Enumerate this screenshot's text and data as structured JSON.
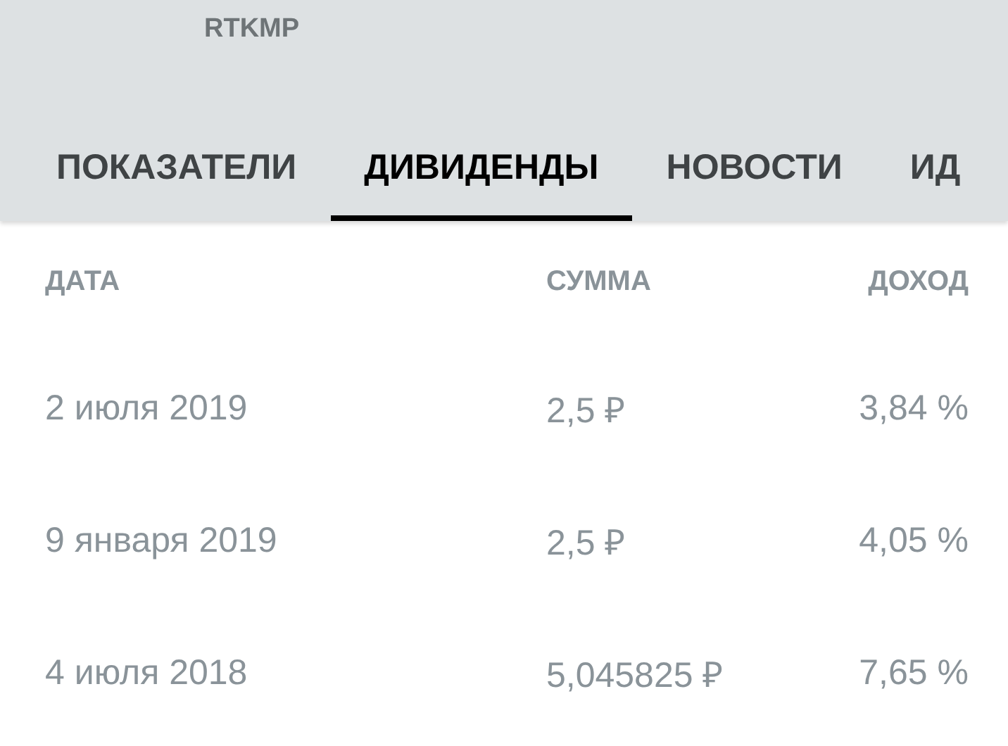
{
  "header": {
    "ticker": "RTKMP"
  },
  "tabs": [
    {
      "label": "ПОКАЗАТЕЛИ",
      "selected": false
    },
    {
      "label": "ДИВИДЕНДЫ",
      "selected": true
    },
    {
      "label": "НОВОСТИ",
      "selected": false
    },
    {
      "label": "ИД",
      "selected": false
    }
  ],
  "table": {
    "columns": [
      "ДАТА",
      "СУММА",
      "ДОХОД"
    ],
    "rows": [
      [
        "2 июля 2019",
        "2,5 ₽",
        "3,84 %"
      ],
      [
        "9 января 2019",
        "2,5 ₽",
        "4,05 %"
      ],
      [
        "4 июля 2018",
        "5,045825 ₽",
        "7,65 %"
      ]
    ]
  }
}
